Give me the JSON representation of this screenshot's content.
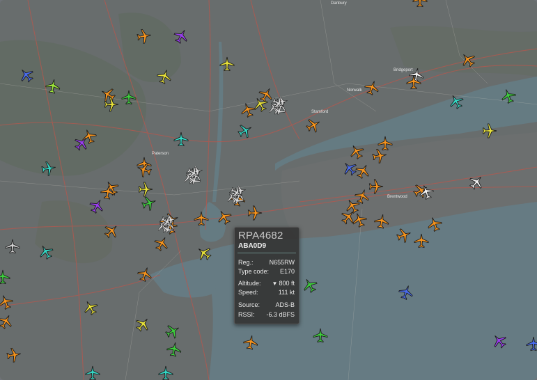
{
  "popup": {
    "callsign": "RPA4682",
    "hex": "ABA0D9",
    "reg_label": "Reg.:",
    "reg_value": "N655RW",
    "type_label": "Type code:",
    "type_value": "E170",
    "alt_label": "Altitude:",
    "alt_arrow": "▼",
    "alt_value": "800 ft",
    "speed_label": "Speed:",
    "speed_value": "111 kt",
    "source_label": "Source:",
    "source_value": "ADS-B",
    "rssi_label": "RSSI:",
    "rssi_value": "-6.3 dBFS"
  },
  "map_labels": {
    "stamford": "Stamford",
    "norwalk": "Norwalk",
    "bridgeport": "Bridgeport",
    "danbury": "Danbury",
    "paterson": "Paterson",
    "brentwood": "Brentwood"
  },
  "colors": {
    "water": "#7d9aa3",
    "land": "#8a8d8c",
    "overlay": "#555a5f"
  },
  "aircraft_colors": [
    "orange",
    "yellow",
    "green",
    "teal",
    "blue",
    "purple",
    "white"
  ]
}
